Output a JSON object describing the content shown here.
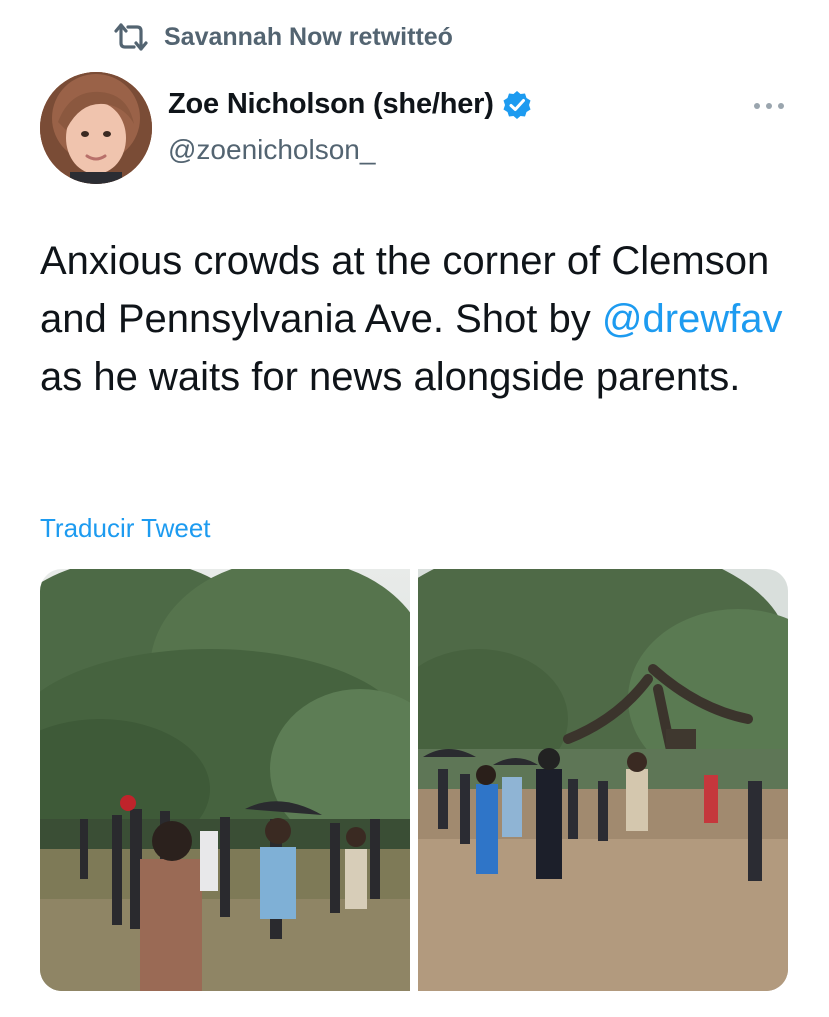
{
  "retweet": {
    "icon": "retweet-icon",
    "text": "Savannah Now retwitteó"
  },
  "author": {
    "name": "Zoe Nicholson (she/her)",
    "handle": "@zoenicholson_",
    "verified": true,
    "avatar": "avatar-photo"
  },
  "tweet": {
    "text_before": "Anxious crowds at the corner of Clemson and Pennsylvania Ave. Shot by ",
    "mention": "@drewfav",
    "text_after": " as he waits for news alongside parents."
  },
  "translate_label": "Traducir Tweet",
  "media": [
    {
      "name": "crowd-photo-left"
    },
    {
      "name": "crowd-photo-right"
    }
  ],
  "colors": {
    "link": "#1d9bf0",
    "secondary_text": "#536471",
    "primary_text": "#0f1419"
  }
}
